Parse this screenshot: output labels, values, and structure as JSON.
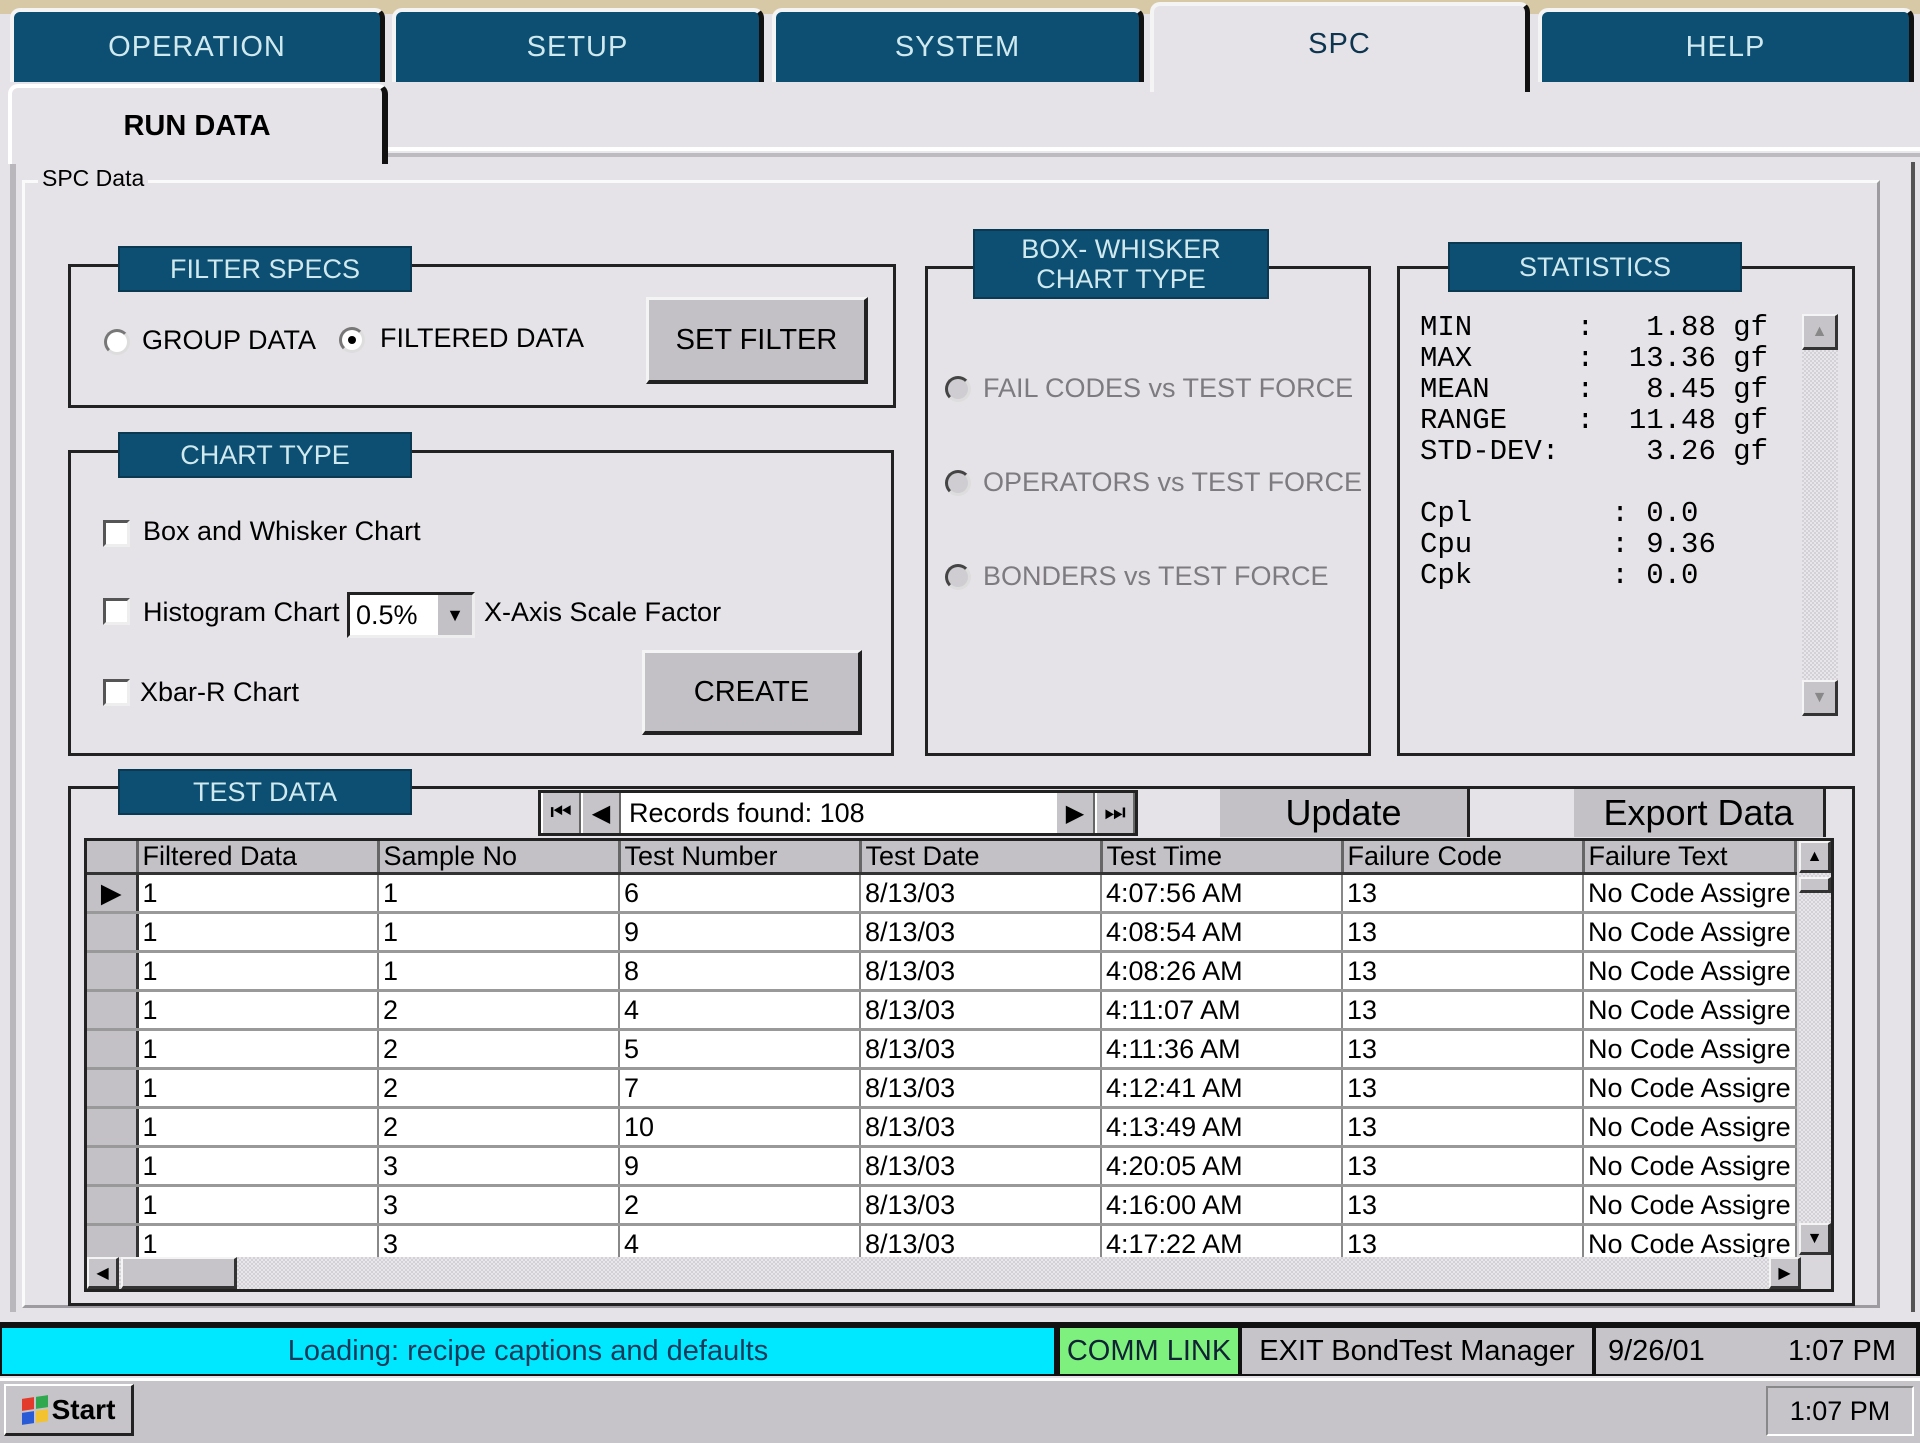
{
  "tabs": [
    {
      "label": "OPERATION",
      "active": false
    },
    {
      "label": "SETUP",
      "active": false
    },
    {
      "label": "SYSTEM",
      "active": false
    },
    {
      "label": "SPC",
      "active": true
    },
    {
      "label": "HELP",
      "active": false
    }
  ],
  "subtab": {
    "label": "RUN DATA"
  },
  "spc_group_label": "SPC Data",
  "filter_specs": {
    "title": "FILTER  SPECS",
    "group_data_label": "GROUP DATA",
    "filtered_data_label": "FILTERED DATA",
    "selected": "FILTERED DATA",
    "set_filter_label": "SET FILTER"
  },
  "chart_type": {
    "title": "CHART TYPE",
    "box_whisker_label": "Box and Whisker Chart",
    "histogram_label": "Histogram Chart",
    "xbar_r_label": "Xbar-R Chart",
    "scale_factor_value": "0.5%",
    "scale_factor_label": "X-Axis Scale Factor",
    "create_label": "CREATE",
    "box_whisker_checked": false,
    "histogram_checked": false,
    "xbar_r_checked": false
  },
  "box_whisker_type": {
    "title": "BOX- WHISKER CHART TYPE",
    "options": [
      "FAIL CODES vs TEST FORCE",
      "OPERATORS vs TEST FORCE",
      "BONDERS vs TEST FORCE"
    ],
    "disabled": true
  },
  "statistics": {
    "title": "STATISTICS",
    "text": "MIN      :   1.88 gf\nMAX      :  13.36 gf\nMEAN     :   8.45 gf\nRANGE    :  11.48 gf\nSTD-DEV:     3.26 gf\n\nCpl        : 0.0\nCpu        : 9.36\nCpk        : 0.0",
    "rows": [
      {
        "label": "MIN",
        "value": "1.88",
        "unit": "gf"
      },
      {
        "label": "MAX",
        "value": "13.36",
        "unit": "gf"
      },
      {
        "label": "MEAN",
        "value": "8.45",
        "unit": "gf"
      },
      {
        "label": "RANGE",
        "value": "11.48",
        "unit": "gf"
      },
      {
        "label": "STD-DEV",
        "value": "3.26",
        "unit": "gf"
      },
      {
        "label": "Cpl",
        "value": "0.0"
      },
      {
        "label": "Cpu",
        "value": "9.36"
      },
      {
        "label": "Cpk",
        "value": "0.0"
      }
    ]
  },
  "test_data": {
    "title": "TEST DATA",
    "records_text": "Records found: 108",
    "update_label": "Update",
    "export_label": "Export Data",
    "columns": [
      "Filtered Data",
      "Sample No",
      "Test Number",
      "Test Date",
      "Test Time",
      "Failure Code",
      "Failure Text"
    ],
    "rows": [
      [
        "1",
        "1",
        "6",
        "8/13/03",
        "4:07:56 AM",
        "13",
        "No Code Assigre"
      ],
      [
        "1",
        "1",
        "9",
        "8/13/03",
        "4:08:54 AM",
        "13",
        "No Code Assigre"
      ],
      [
        "1",
        "1",
        "8",
        "8/13/03",
        "4:08:26 AM",
        "13",
        "No Code Assigre"
      ],
      [
        "1",
        "2",
        "4",
        "8/13/03",
        "4:11:07 AM",
        "13",
        "No Code Assigre"
      ],
      [
        "1",
        "2",
        "5",
        "8/13/03",
        "4:11:36 AM",
        "13",
        "No Code Assigre"
      ],
      [
        "1",
        "2",
        "7",
        "8/13/03",
        "4:12:41 AM",
        "13",
        "No Code Assigre"
      ],
      [
        "1",
        "2",
        "10",
        "8/13/03",
        "4:13:49 AM",
        "13",
        "No Code Assigre"
      ],
      [
        "1",
        "3",
        "9",
        "8/13/03",
        "4:20:05 AM",
        "13",
        "No Code Assigre"
      ],
      [
        "1",
        "3",
        "2",
        "8/13/03",
        "4:16:00 AM",
        "13",
        "No Code Assigre"
      ],
      [
        "1",
        "3",
        "4",
        "8/13/03",
        "4:17:22 AM",
        "13",
        "No Code Assigre"
      ]
    ],
    "current_row_index": 0
  },
  "status_bar": {
    "message": "Loading: recipe captions and defaults",
    "comm_link": "COMM LINK",
    "exit_label": "EXIT BondTest Manager",
    "date": "9/26/01",
    "time": "1:07 PM",
    "message_color": "#00e8ff",
    "comm_color": "#7df07d"
  },
  "taskbar": {
    "start_label": "Start",
    "clock": "1:07 PM"
  },
  "colors": {
    "tab_blue": "#0d4f72",
    "tab_text": "#cfe9ee"
  }
}
